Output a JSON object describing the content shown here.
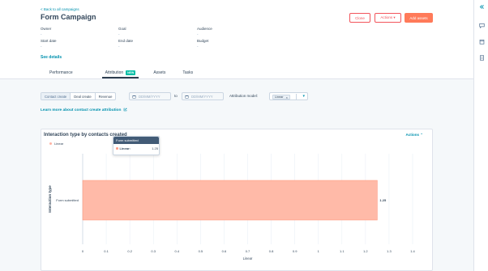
{
  "header": {
    "back_link": "< Back to all campaigns",
    "title": "Form Campaign",
    "clone_label": "Clone",
    "actions_label": "Actions ▾",
    "add_assets_label": "Add assets",
    "meta": [
      {
        "label": "Owner",
        "value": "-"
      },
      {
        "label": "Goal",
        "value": "-"
      },
      {
        "label": "Audience",
        "value": "-"
      },
      {
        "label": "Start date",
        "value": "-"
      },
      {
        "label": "End date",
        "value": "-"
      },
      {
        "label": "Budget",
        "value": "-"
      }
    ],
    "see_details": "See details"
  },
  "tabs": [
    {
      "label": "Performance",
      "active": false
    },
    {
      "label": "Attribution",
      "active": true,
      "badge": "NEW"
    },
    {
      "label": "Assets",
      "active": false
    },
    {
      "label": "Tasks",
      "active": false
    }
  ],
  "filters": {
    "segments": [
      "Contact create",
      "Deal create",
      "Revenue"
    ],
    "selected_segment": "Contact create",
    "start_date_placeholder": "DD/MM/YYYY",
    "to_label": "to",
    "end_date_placeholder": "DD/MM/YYYY",
    "attribution_model_label": "Attribution model:",
    "attribution_model_value": "Linear"
  },
  "learn_more": "Learn more about contact create attribution",
  "rail_icons": [
    "chevrons-left-icon",
    "chat-icon",
    "calendar-icon",
    "document-icon"
  ],
  "card": {
    "title": "Interaction type by contacts created",
    "actions_label": "Actions ⌃",
    "tooltip": {
      "header": "Form submitted",
      "series": "Linear:",
      "value": "1.25"
    }
  },
  "colors": {
    "accent": "#ff7a59",
    "link": "#0091ae",
    "bar": "#ffbaa8",
    "bar_stroke": "#ff8f73",
    "text": "#33475b",
    "background": "#f5f8fa"
  },
  "chart_data": {
    "type": "bar",
    "orientation": "horizontal",
    "categories": [
      "Form submitted"
    ],
    "series": [
      {
        "name": "Linear",
        "values": [
          1.25
        ]
      }
    ],
    "data_labels": [
      "1.25"
    ],
    "xlabel": "Linear",
    "ylabel": "Interaction type",
    "xlim": [
      0,
      1.4
    ],
    "xticks": [
      "0",
      "0.1",
      "0.2",
      "0.3",
      "0.4",
      "0.5",
      "0.6",
      "0.7",
      "0.8",
      "0.9",
      "1",
      "1.1",
      "1.2",
      "1.3",
      "1.4"
    ],
    "grid": true,
    "legend": "top-left"
  }
}
